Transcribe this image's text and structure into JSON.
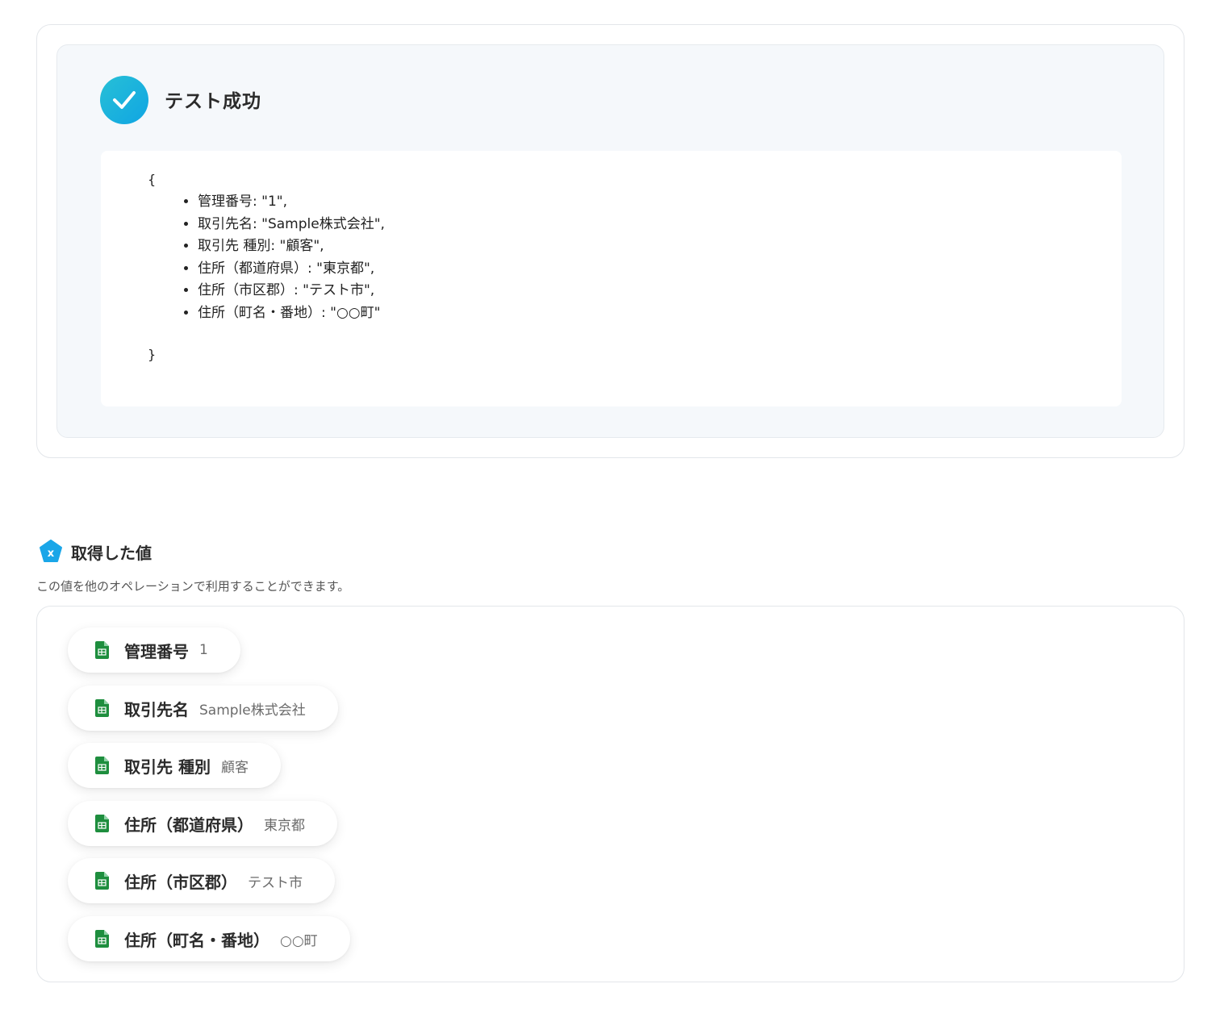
{
  "test_result": {
    "title": "テスト成功",
    "icon": "check-icon",
    "accent_color": "#10a5e3",
    "json_open": "{",
    "json_close": "}",
    "items": [
      "管理番号: \"1\",",
      "取引先名: \"Sample株式会社\",",
      "取引先 種別: \"顧客\",",
      "住所（都道府県）: \"東京都\",",
      "住所（市区郡）: \"テスト市\",",
      "住所（町名・番地）: \"○○町\""
    ]
  },
  "acquired": {
    "title": "取得した値",
    "icon": "variable-icon",
    "description": "この値を他のオペレーションで利用することができます。",
    "item_icon": "google-sheets-icon",
    "sheet_color": "#1e8e3e",
    "items": [
      {
        "label": "管理番号",
        "value": "1"
      },
      {
        "label": "取引先名",
        "value": "Sample株式会社"
      },
      {
        "label": "取引先 種別",
        "value": "顧客"
      },
      {
        "label": "住所（都道府県）",
        "value": "東京都"
      },
      {
        "label": "住所（市区郡）",
        "value": "テスト市"
      },
      {
        "label": "住所（町名・番地）",
        "value": "○○町"
      }
    ]
  }
}
